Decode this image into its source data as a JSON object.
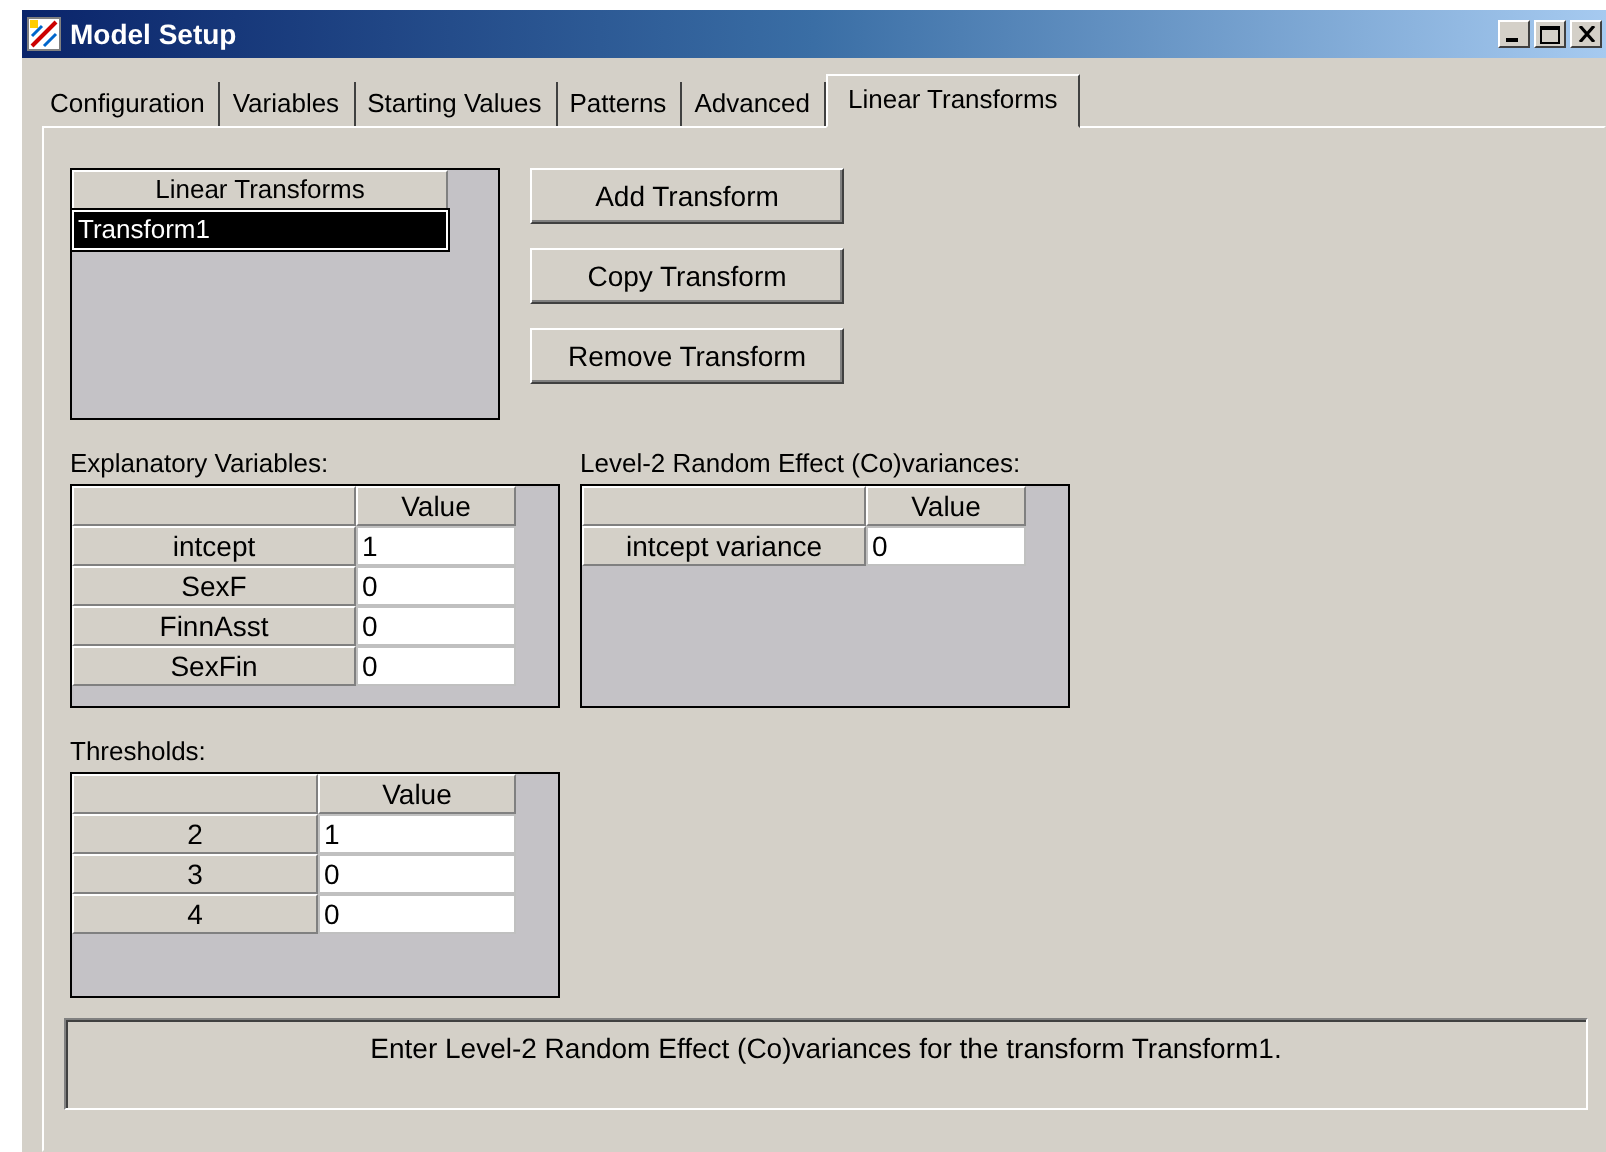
{
  "window": {
    "title": "Model Setup"
  },
  "tabs": [
    {
      "label": "Configuration",
      "selected": false
    },
    {
      "label": "Variables",
      "selected": false
    },
    {
      "label": "Starting Values",
      "selected": false
    },
    {
      "label": "Patterns",
      "selected": false
    },
    {
      "label": "Advanced",
      "selected": false
    },
    {
      "label": "Linear Transforms",
      "selected": true
    }
  ],
  "transforms": {
    "header": "Linear Transforms",
    "items": [
      {
        "label": "Transform1",
        "selected": true
      }
    ]
  },
  "buttons": [
    {
      "label": "Add Transform"
    },
    {
      "label": "Copy Transform"
    },
    {
      "label": "Remove Transform"
    }
  ],
  "explanatory_variables": {
    "title": "Explanatory Variables:",
    "value_header": "Value",
    "rows": [
      {
        "name": "intcept",
        "value": "1"
      },
      {
        "name": "SexF",
        "value": "0"
      },
      {
        "name": "FinnAsst",
        "value": "0"
      },
      {
        "name": "SexFin",
        "value": "0"
      }
    ]
  },
  "random_effects": {
    "title": "Level-2 Random Effect (Co)variances:",
    "value_header": "Value",
    "rows": [
      {
        "name": "intcept variance",
        "value": "0"
      }
    ]
  },
  "thresholds": {
    "title": "Thresholds:",
    "value_header": "Value",
    "rows": [
      {
        "name": "2",
        "value": "1"
      },
      {
        "name": "3",
        "value": "0"
      },
      {
        "name": "4",
        "value": "0"
      }
    ]
  },
  "status_bar": "Enter Level-2 Random Effect (Co)variances for the transform Transform1."
}
